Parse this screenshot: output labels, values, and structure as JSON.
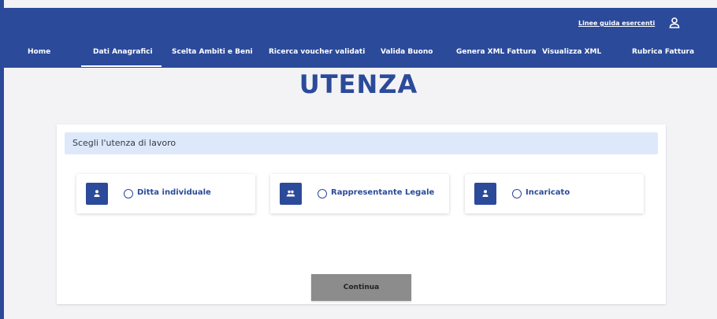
{
  "header": {
    "guide_link": "Linee guida esercenti",
    "user_icon": "user-icon"
  },
  "nav": {
    "items": [
      "Home",
      "Dati Anagrafici",
      "Scelta Ambiti e Beni",
      "Ricerca voucher validati",
      "Valida Buono",
      "Genera XML Fattura",
      "Visualizza XML",
      "Rubrica Fattura"
    ],
    "active": "Dati Anagrafici"
  },
  "page": {
    "title": "UTENZA"
  },
  "card": {
    "header": "Scegli l'utenza di lavoro",
    "options": [
      {
        "label": "Ditta individuale",
        "icon": "person-icon",
        "selected": false
      },
      {
        "label": "Rappresentante Legale",
        "icon": "people-icon",
        "selected": false
      },
      {
        "label": "Incaricato",
        "icon": "person-icon",
        "selected": false
      }
    ],
    "continue_label": "Continua"
  },
  "colors": {
    "primary": "#2b4a9a",
    "card_header_bg": "#dde9fb",
    "button_bg": "#8c8c8c"
  }
}
